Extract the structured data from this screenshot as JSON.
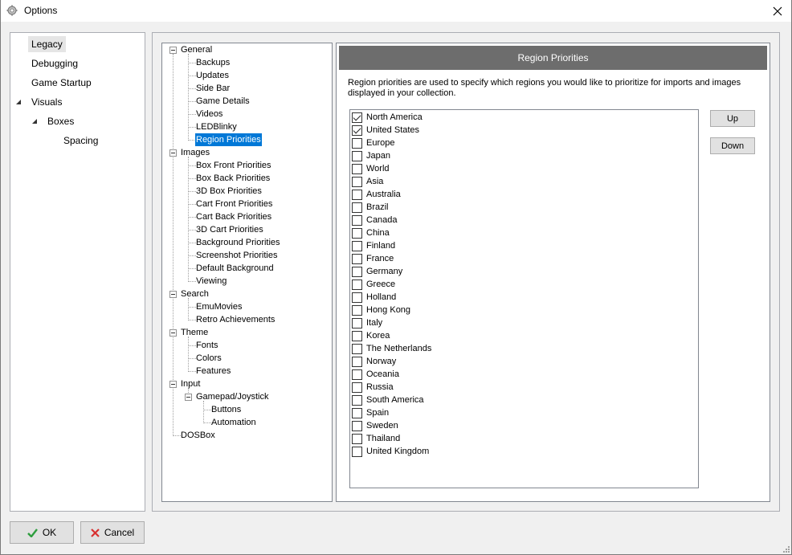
{
  "window": {
    "title": "Options",
    "title_icon": "gear-icon",
    "close_icon": "close-icon"
  },
  "sidebar": {
    "items": [
      {
        "label": "Legacy",
        "level": 0,
        "selected": true
      },
      {
        "label": "Debugging",
        "level": 0
      },
      {
        "label": "Game Startup",
        "level": 0
      },
      {
        "label": "Visuals",
        "level": 0,
        "expanded": true
      },
      {
        "label": "Boxes",
        "level": 1,
        "expanded": true
      },
      {
        "label": "Spacing",
        "level": 2
      }
    ]
  },
  "tree": {
    "general": "General",
    "general_children": [
      "Backups",
      "Updates",
      "Side Bar",
      "Game Details",
      "Videos",
      "LEDBlinky",
      "Region Priorities"
    ],
    "images": "Images",
    "images_children": [
      "Box Front Priorities",
      "Box Back Priorities",
      "3D Box Priorities",
      "Cart Front Priorities",
      "Cart Back Priorities",
      "3D Cart Priorities",
      "Background Priorities",
      "Screenshot Priorities",
      "Default Background",
      "Viewing"
    ],
    "search": "Search",
    "search_children": [
      "EmuMovies",
      "Retro Achievements"
    ],
    "theme": "Theme",
    "theme_children": [
      "Fonts",
      "Colors",
      "Features"
    ],
    "input": "Input",
    "gamepad": "Gamepad/Joystick",
    "gamepad_children": [
      "Buttons",
      "Automation"
    ],
    "dosbox": "DOSBox",
    "selected": "Region Priorities"
  },
  "panel": {
    "title": "Region Priorities",
    "description": "Region priorities are used to specify which regions you would like to prioritize for imports and images displayed in your collection.",
    "regions": [
      {
        "label": "North America",
        "checked": true
      },
      {
        "label": "United States",
        "checked": true
      },
      {
        "label": "Europe",
        "checked": false
      },
      {
        "label": "Japan",
        "checked": false
      },
      {
        "label": "World",
        "checked": false
      },
      {
        "label": "Asia",
        "checked": false
      },
      {
        "label": "Australia",
        "checked": false
      },
      {
        "label": "Brazil",
        "checked": false
      },
      {
        "label": "Canada",
        "checked": false
      },
      {
        "label": "China",
        "checked": false
      },
      {
        "label": "Finland",
        "checked": false
      },
      {
        "label": "France",
        "checked": false
      },
      {
        "label": "Germany",
        "checked": false
      },
      {
        "label": "Greece",
        "checked": false
      },
      {
        "label": "Holland",
        "checked": false
      },
      {
        "label": "Hong Kong",
        "checked": false
      },
      {
        "label": "Italy",
        "checked": false
      },
      {
        "label": "Korea",
        "checked": false
      },
      {
        "label": "The Netherlands",
        "checked": false
      },
      {
        "label": "Norway",
        "checked": false
      },
      {
        "label": "Oceania",
        "checked": false
      },
      {
        "label": "Russia",
        "checked": false
      },
      {
        "label": "South America",
        "checked": false
      },
      {
        "label": "Spain",
        "checked": false
      },
      {
        "label": "Sweden",
        "checked": false
      },
      {
        "label": "Thailand",
        "checked": false
      },
      {
        "label": "United Kingdom",
        "checked": false
      }
    ],
    "up_label": "Up",
    "down_label": "Down"
  },
  "footer": {
    "ok_label": "OK",
    "ok_icon": "checkmark-icon",
    "cancel_label": "Cancel",
    "cancel_icon": "x-icon",
    "ok_icon_color": "#2e9e3e",
    "cancel_icon_color": "#d83030"
  }
}
